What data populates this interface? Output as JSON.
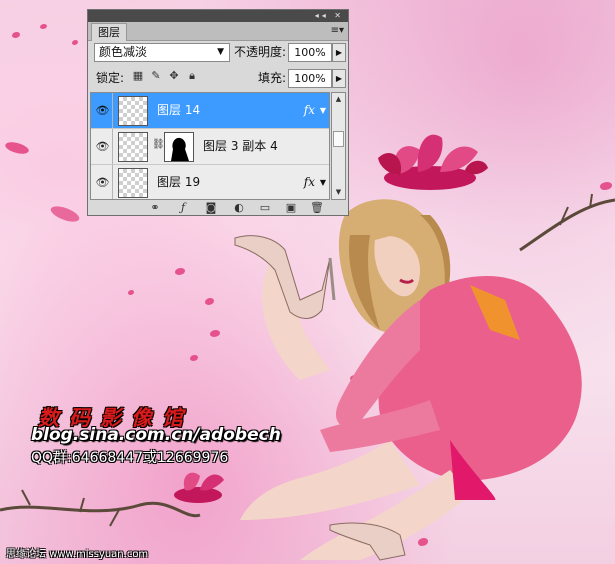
{
  "layers_panel": {
    "tab_label": "图层",
    "blend_mode": "颜色减淡",
    "opacity_label": "不透明度:",
    "opacity_value": "100%",
    "lock_label": "锁定:",
    "fill_label": "填充:",
    "fill_value": "100%",
    "layers": [
      {
        "name": "图层 14",
        "selected": true,
        "has_fx": true,
        "fx_label": "fx"
      },
      {
        "name": "图层 3 副本 4",
        "selected": false,
        "has_fx": false
      },
      {
        "name": "图层 19",
        "selected": false,
        "has_fx": true,
        "fx_label": "fx"
      }
    ],
    "bottom_buttons": [
      "link-icon",
      "fx-icon",
      "mask-icon",
      "adjustment-icon",
      "folder-icon",
      "new-layer-icon",
      "trash-icon"
    ]
  },
  "watermark": {
    "title": "数码影像馆",
    "blog": "blog.sina.com.cn/adobech",
    "qq": "QQ群:64668447或12669976",
    "footer": "思缘论坛 www.missyuan.com"
  },
  "colors": {
    "selected_layer": "#3d9bff",
    "panel_bg": "#d9d9d9",
    "title_red": "#d81a1a",
    "petal_pink": "#e23d7e"
  }
}
